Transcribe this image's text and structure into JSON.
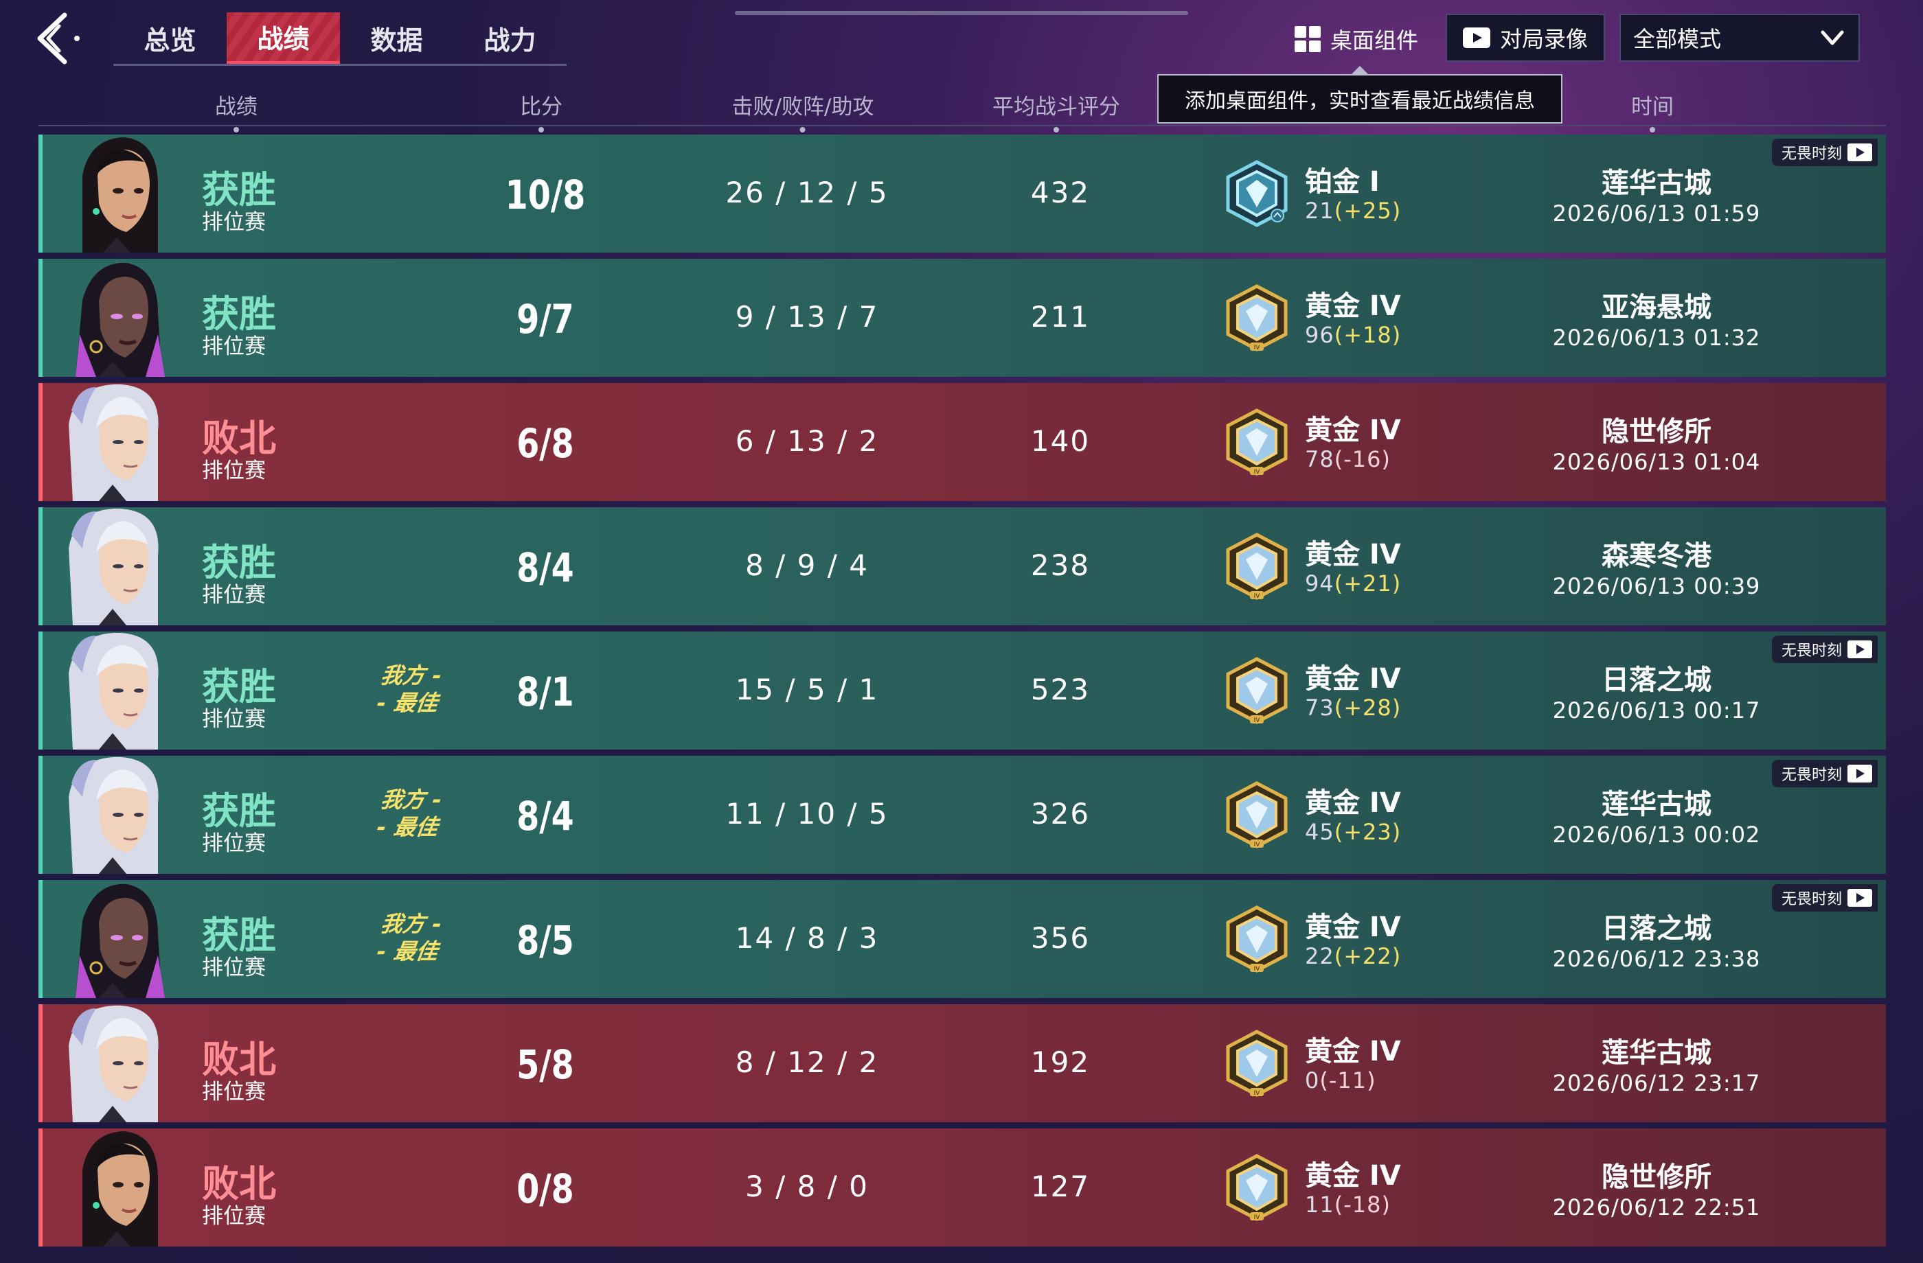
{
  "tabs": [
    {
      "label": "总览",
      "active": false
    },
    {
      "label": "战绩",
      "active": true
    },
    {
      "label": "数据",
      "active": false
    },
    {
      "label": "战力",
      "active": false
    }
  ],
  "toolbar": {
    "widget_label": "桌面组件",
    "replay_label": "对局录像",
    "mode_select_value": "全部模式"
  },
  "tooltip": "添加桌面组件，实时查看最近战绩信息",
  "columns": {
    "record": "战绩",
    "score": "比分",
    "kda": "击败/败阵/助攻",
    "rating": "平均战斗评分",
    "time": "时间"
  },
  "colors": {
    "win": "#2b6a63",
    "loss": "#8a2f3e",
    "win_text": "#7fe3c4",
    "loss_text": "#ff8e95",
    "mvp": "#f7e36a"
  },
  "rows": [
    {
      "result": "获胜",
      "outcome": "win",
      "mode": "排位赛",
      "mvp": "",
      "score": "10/8",
      "kda": "26 / 12 / 5",
      "rating": "432",
      "rank": "铂金 I",
      "rank_tier": "platinum",
      "points": "21",
      "delta": "(+25)",
      "map": "莲华古城",
      "time": "2026/06/13 01:59",
      "moment": "无畏时刻",
      "hero": "dark-hair"
    },
    {
      "result": "获胜",
      "outcome": "win",
      "mode": "排位赛",
      "mvp": "",
      "score": "9/7",
      "kda": "9 / 13 / 7",
      "rating": "211",
      "rank": "黄金 IV",
      "rank_tier": "gold",
      "points": "96",
      "delta": "(+18)",
      "map": "亚海悬城",
      "time": "2026/06/13 01:32",
      "moment": "",
      "hero": "purple-hair"
    },
    {
      "result": "败北",
      "outcome": "loss",
      "mode": "排位赛",
      "mvp": "",
      "score": "6/8",
      "kda": "6 / 13 / 2",
      "rating": "140",
      "rank": "黄金 IV",
      "rank_tier": "gold",
      "points": "78",
      "delta": "(-16)",
      "map": "隐世修所",
      "time": "2026/06/13 01:04",
      "moment": "",
      "hero": "white-hair"
    },
    {
      "result": "获胜",
      "outcome": "win",
      "mode": "排位赛",
      "mvp": "",
      "score": "8/4",
      "kda": "8 / 9 / 4",
      "rating": "238",
      "rank": "黄金 IV",
      "rank_tier": "gold",
      "points": "94",
      "delta": "(+21)",
      "map": "森寒冬港",
      "time": "2026/06/13 00:39",
      "moment": "",
      "hero": "white-hair"
    },
    {
      "result": "获胜",
      "outcome": "win",
      "mode": "排位赛",
      "mvp": "我方 -\n- 最佳",
      "score": "8/1",
      "kda": "15 / 5 / 1",
      "rating": "523",
      "rank": "黄金 IV",
      "rank_tier": "gold",
      "points": "73",
      "delta": "(+28)",
      "map": "日落之城",
      "time": "2026/06/13 00:17",
      "moment": "无畏时刻",
      "hero": "white-hair"
    },
    {
      "result": "获胜",
      "outcome": "win",
      "mode": "排位赛",
      "mvp": "我方 -\n- 最佳",
      "score": "8/4",
      "kda": "11 / 10 / 5",
      "rating": "326",
      "rank": "黄金 IV",
      "rank_tier": "gold",
      "points": "45",
      "delta": "(+23)",
      "map": "莲华古城",
      "time": "2026/06/13 00:02",
      "moment": "无畏时刻",
      "hero": "white-hair"
    },
    {
      "result": "获胜",
      "outcome": "win",
      "mode": "排位赛",
      "mvp": "我方 -\n- 最佳",
      "score": "8/5",
      "kda": "14 / 8 / 3",
      "rating": "356",
      "rank": "黄金 IV",
      "rank_tier": "gold",
      "points": "22",
      "delta": "(+22)",
      "map": "日落之城",
      "time": "2026/06/12 23:38",
      "moment": "无畏时刻",
      "hero": "purple-hair"
    },
    {
      "result": "败北",
      "outcome": "loss",
      "mode": "排位赛",
      "mvp": "",
      "score": "5/8",
      "kda": "8 / 12 / 2",
      "rating": "192",
      "rank": "黄金 IV",
      "rank_tier": "gold",
      "points": "0",
      "delta": "(-11)",
      "map": "莲华古城",
      "time": "2026/06/12 23:17",
      "moment": "",
      "hero": "white-hair"
    },
    {
      "result": "败北",
      "outcome": "loss",
      "mode": "排位赛",
      "mvp": "",
      "score": "0/8",
      "kda": "3 / 8 / 0",
      "rating": "127",
      "rank": "黄金 IV",
      "rank_tier": "gold",
      "points": "11",
      "delta": "(-18)",
      "map": "隐世修所",
      "time": "2026/06/12 22:51",
      "moment": "",
      "hero": "dark-hair"
    }
  ]
}
